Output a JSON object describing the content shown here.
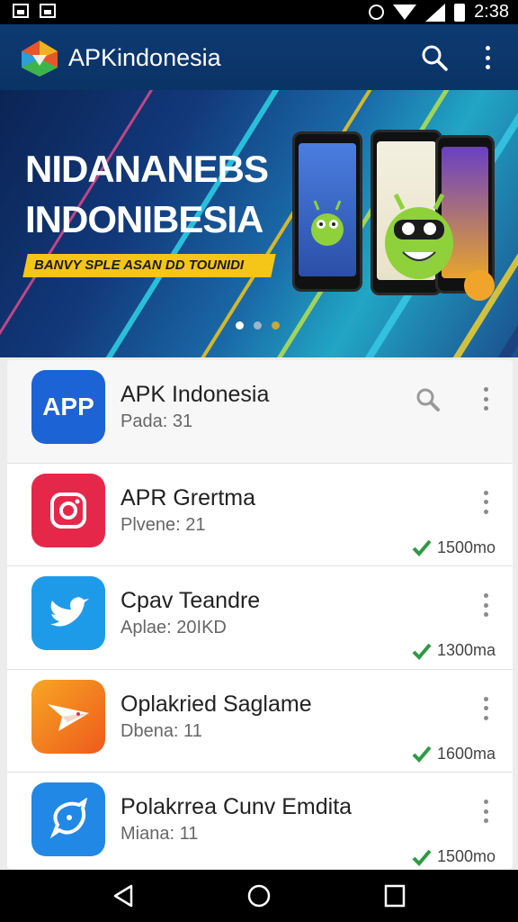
{
  "status_bar": {
    "time": "2:38"
  },
  "app_bar": {
    "title": "APKindonesia"
  },
  "banner": {
    "line1": "NIDANANEBS",
    "line2": "INDONIBESIA",
    "tagline": "BANVY SPLE ASAN DD TOUNIDI",
    "active_page": 1,
    "page_count": 3
  },
  "apps": [
    {
      "name": "APK Indonesia",
      "sub": "Pada: 31",
      "icon": "app-text-icon",
      "icon_text": "APP",
      "color": "#1c63d6",
      "downloads": ""
    },
    {
      "name": "APR Grertma",
      "sub": "Plvene: 21",
      "icon": "instagram-icon",
      "color": "#e5284a",
      "downloads": "1500mo"
    },
    {
      "name": "Cpav Teandre",
      "sub": "Aplae: 20IKD",
      "icon": "bird-icon",
      "color": "#1e9be8",
      "downloads": "1300ma"
    },
    {
      "name": "Oplakried Saglame",
      "sub": "Dbena: 11",
      "icon": "paper-plane-icon",
      "color": "#f47c20",
      "downloads": "1600ma"
    },
    {
      "name": "Polakrrea Cunv Emdita",
      "sub": "Miana: 11",
      "icon": "chat-leaf-icon",
      "color": "#2288e6",
      "downloads": "1500mo"
    }
  ],
  "nav": {
    "back": "back-icon",
    "home": "home-icon",
    "recents": "recents-icon"
  }
}
